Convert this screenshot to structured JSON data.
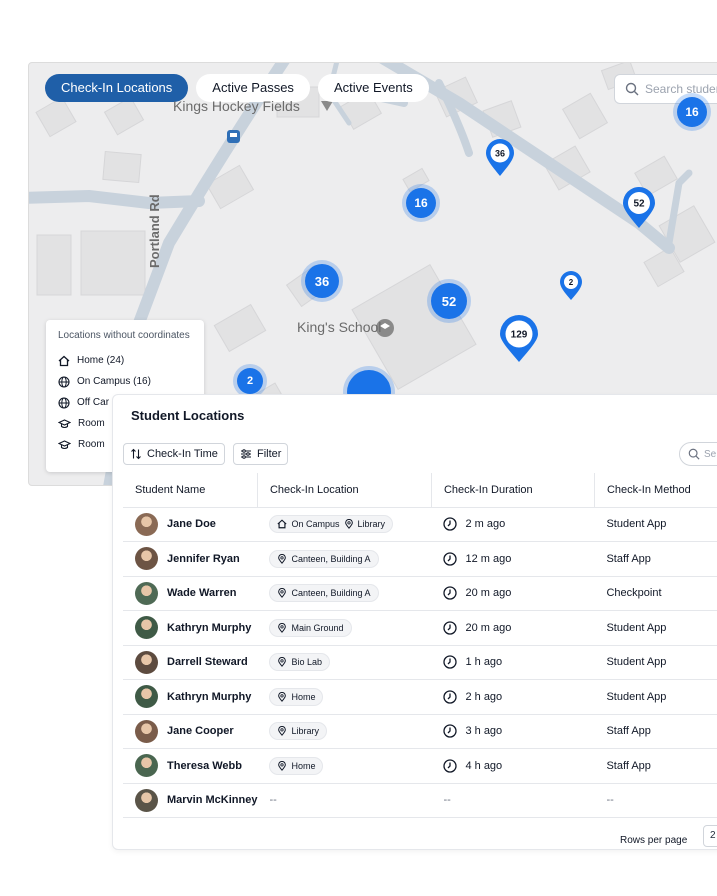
{
  "map": {
    "tabs": [
      {
        "label": "Check-In Locations",
        "active": true
      },
      {
        "label": "Active Passes",
        "active": false
      },
      {
        "label": "Active Events",
        "active": false
      }
    ],
    "search_placeholder": "Search student",
    "labels": {
      "hockey_fields": "Kings Hockey Fields",
      "school": "King's School",
      "portland_rd": "Portland Rd"
    },
    "clusters": [
      {
        "value": "16"
      },
      {
        "value": "16"
      },
      {
        "value": "36"
      },
      {
        "value": "52"
      },
      {
        "value": "2"
      },
      {
        "value": "129"
      }
    ],
    "pins": [
      {
        "value": "36"
      },
      {
        "value": "52"
      },
      {
        "value": "2"
      },
      {
        "value": "129"
      }
    ],
    "accent_color": "#1a73e8",
    "legend": {
      "title": "Locations without coordinates",
      "items": [
        {
          "icon": "home-icon",
          "label": "Home (24)"
        },
        {
          "icon": "globe-icon",
          "label": "On Campus (16)"
        },
        {
          "icon": "globe-icon",
          "label": "Off Car"
        },
        {
          "icon": "graduation-cap-icon",
          "label": "Room"
        },
        {
          "icon": "graduation-cap-icon",
          "label": "Room"
        }
      ]
    }
  },
  "panel": {
    "title": "Student Locations",
    "sort_label": "Check-In Time",
    "filter_label": "Filter",
    "search_placeholder": "Se",
    "columns": [
      "Student Name",
      "Check-In Location",
      "Check-In Duration",
      "Check-In Method"
    ],
    "rows": [
      {
        "name": "Jane Doe",
        "locations": [
          "On Campus",
          "Library"
        ],
        "loc_icons": [
          "home-icon",
          "pin-icon"
        ],
        "duration": "2 m ago",
        "method": "Student App",
        "avatar_color": "#8a6a55"
      },
      {
        "name": "Jennifer Ryan",
        "locations": [
          "Canteen, Building A"
        ],
        "loc_icons": [
          "pin-icon"
        ],
        "duration": "12 m ago",
        "method": "Staff App",
        "avatar_color": "#6d5444"
      },
      {
        "name": "Wade Warren",
        "locations": [
          "Canteen, Building A"
        ],
        "loc_icons": [
          "pin-icon"
        ],
        "duration": "20 m ago",
        "method": "Checkpoint",
        "avatar_color": "#4f6a55"
      },
      {
        "name": "Kathryn Murphy",
        "locations": [
          "Main Ground"
        ],
        "loc_icons": [
          "pin-icon"
        ],
        "duration": "20 m ago",
        "method": "Student App",
        "avatar_color": "#3f5a46"
      },
      {
        "name": "Darrell Steward",
        "locations": [
          "Bio Lab"
        ],
        "loc_icons": [
          "pin-icon"
        ],
        "duration": "1 h ago",
        "method": "Student App",
        "avatar_color": "#5d4b3f"
      },
      {
        "name": "Kathryn Murphy",
        "locations": [
          "Home"
        ],
        "loc_icons": [
          "pin-icon"
        ],
        "duration": "2 h ago",
        "method": "Student App",
        "avatar_color": "#3f5a46"
      },
      {
        "name": "Jane Cooper",
        "locations": [
          "Library"
        ],
        "loc_icons": [
          "pin-icon"
        ],
        "duration": "3 h ago",
        "method": "Staff App",
        "avatar_color": "#7a5c4a"
      },
      {
        "name": "Theresa Webb",
        "locations": [
          "Home"
        ],
        "loc_icons": [
          "pin-icon"
        ],
        "duration": "4 h ago",
        "method": "Staff App",
        "avatar_color": "#4a6650"
      },
      {
        "name": "Marvin McKinney",
        "locations": [],
        "loc_icons": [],
        "duration": "--",
        "method": "--",
        "avatar_color": "#5a5448",
        "empty_location": "--"
      }
    ],
    "rows_per_page_label": "Rows per page",
    "rows_per_page_value": "2"
  }
}
